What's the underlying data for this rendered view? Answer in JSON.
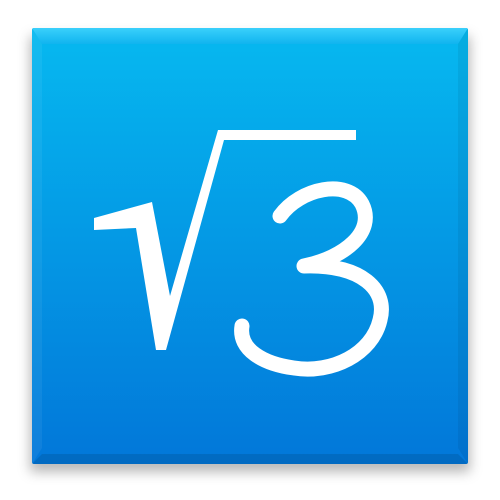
{
  "app_icon": {
    "name": "sqrt-3-app-icon",
    "gradient_top": "#06b9f0",
    "gradient_bottom": "#0277d9",
    "bevel_top": "#3ad0fb",
    "glyph_color": "#ffffff",
    "icons": [
      "square-root-icon",
      "digit-3-icon"
    ]
  }
}
